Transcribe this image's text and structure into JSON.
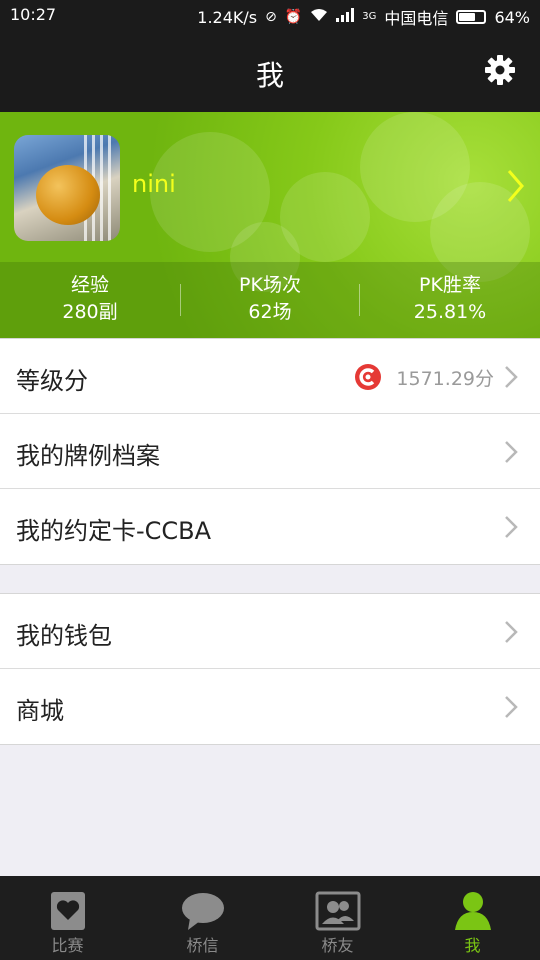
{
  "status_bar": {
    "time": "10:27",
    "net_speed": "1.24K/s",
    "network_type": "3G",
    "carrier": "中国电信",
    "battery_text": "64%",
    "battery_level": 0.64
  },
  "header": {
    "title": "我",
    "settings_icon": "gear-icon"
  },
  "profile": {
    "username": "nini",
    "stats": [
      {
        "label": "经验",
        "value": "280副"
      },
      {
        "label": "PK场次",
        "value": "62场"
      },
      {
        "label": "PK胜率",
        "value": "25.81%"
      }
    ]
  },
  "menu_group_1": [
    {
      "label": "等级分",
      "score": "1571.29分",
      "score_icon": "ranking-badge-icon"
    },
    {
      "label": "我的牌例档案"
    },
    {
      "label": "我的约定卡-CCBA"
    }
  ],
  "menu_group_2": [
    {
      "label": "我的钱包"
    },
    {
      "label": "商城"
    }
  ],
  "tabbar": {
    "tabs": [
      {
        "label": "比赛",
        "icon": "heart-card-icon",
        "active": false
      },
      {
        "label": "桥信",
        "icon": "chat-bubble-icon",
        "active": false
      },
      {
        "label": "桥友",
        "icon": "contacts-icon",
        "active": false
      },
      {
        "label": "我",
        "icon": "person-icon",
        "active": true
      }
    ]
  },
  "colors": {
    "accent": "#7bc514",
    "banner_green": "#86c919",
    "username": "#f3ff1c",
    "bar_bg": "#1b1b1b"
  }
}
